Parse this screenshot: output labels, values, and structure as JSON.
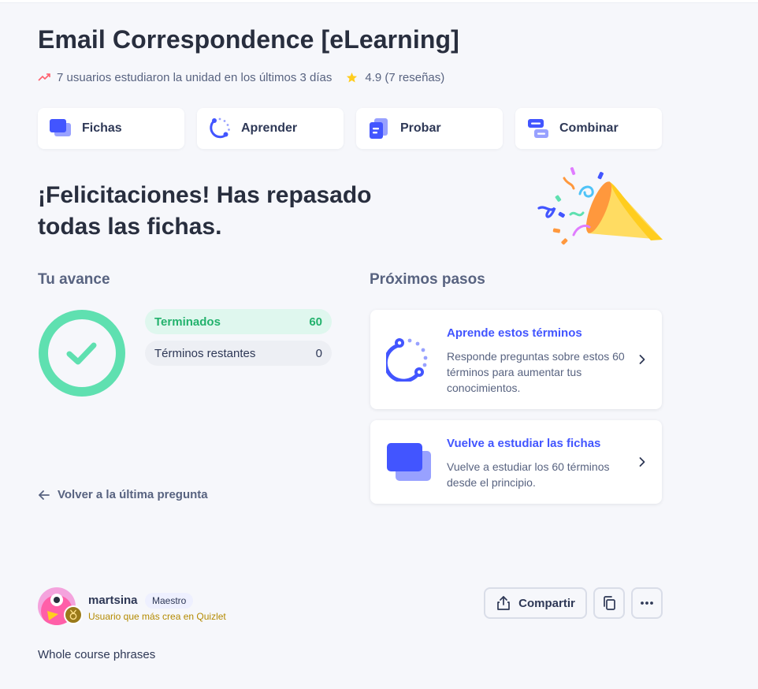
{
  "set": {
    "title": "Email Correspondence [eLearning]",
    "activity_text": "7 usuarios estudiaron la unidad en los últimos 3 días",
    "rating_text": "4.9 (7 reseñas)",
    "description": "Whole course phrases"
  },
  "modes": [
    {
      "label": "Fichas",
      "icon": "flashcards-icon"
    },
    {
      "label": "Aprender",
      "icon": "learn-icon"
    },
    {
      "label": "Probar",
      "icon": "test-icon"
    },
    {
      "label": "Combinar",
      "icon": "match-icon"
    }
  ],
  "congrats": {
    "headline": "¡Felicitaciones! Has repasado todas las fichas."
  },
  "progress": {
    "section_title": "Tu avance",
    "done_label": "Terminados",
    "done_count": "60",
    "remaining_label": "Términos restantes",
    "remaining_count": "0",
    "back_link": "Volver a la última pregunta"
  },
  "next_steps": {
    "section_title": "Próximos pasos",
    "cards": [
      {
        "title": "Aprende estos términos",
        "desc": "Responde preguntas sobre estos 60 términos para aumentar tus conocimientos."
      },
      {
        "title": "Vuelve a estudiar las fichas",
        "desc": "Vuelve a estudiar los 60 términos desde el principio."
      }
    ]
  },
  "author": {
    "username": "martsina",
    "role": "Maestro",
    "subtitle": "Usuario que más crea en Quizlet"
  },
  "actions": {
    "share_label": "Compartir"
  },
  "colors": {
    "accent": "#4255ff",
    "success": "#23b26d",
    "ring": "#5fe0b0",
    "star": "#ffcd1f"
  }
}
